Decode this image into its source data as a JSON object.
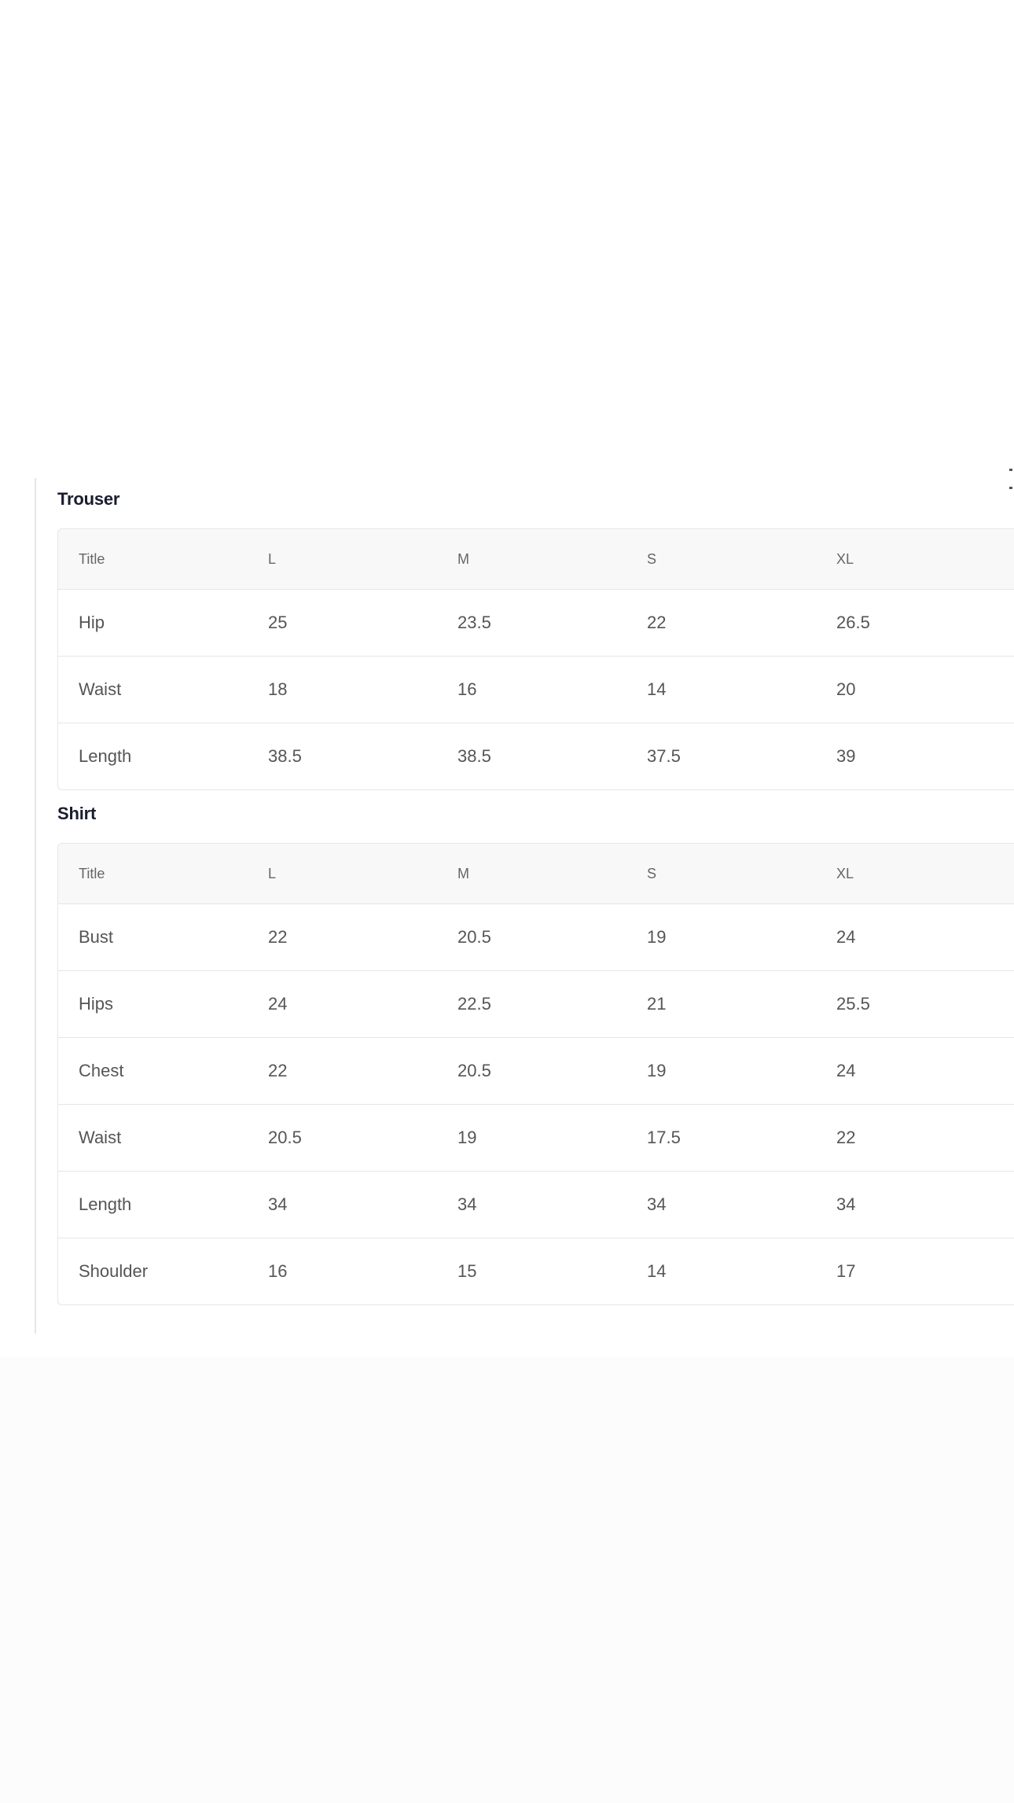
{
  "sections": [
    {
      "title": "Trouser",
      "columns": [
        "Title",
        "L",
        "M",
        "S",
        "XL"
      ],
      "rows": [
        [
          "Hip",
          "25",
          "23.5",
          "22",
          "26.5"
        ],
        [
          "Waist",
          "18",
          "16",
          "14",
          "20"
        ],
        [
          "Length",
          "38.5",
          "38.5",
          "37.5",
          "39"
        ]
      ]
    },
    {
      "title": "Shirt",
      "columns": [
        "Title",
        "L",
        "M",
        "S",
        "XL"
      ],
      "rows": [
        [
          "Bust",
          "22",
          "20.5",
          "19",
          "24"
        ],
        [
          "Hips",
          "24",
          "22.5",
          "21",
          "25.5"
        ],
        [
          "Chest",
          "22",
          "20.5",
          "19",
          "24"
        ],
        [
          "Waist",
          "20.5",
          "19",
          "17.5",
          "22"
        ],
        [
          "Length",
          "34",
          "34",
          "34",
          "34"
        ],
        [
          "Shoulder",
          "16",
          "15",
          "14",
          "17"
        ]
      ]
    }
  ]
}
